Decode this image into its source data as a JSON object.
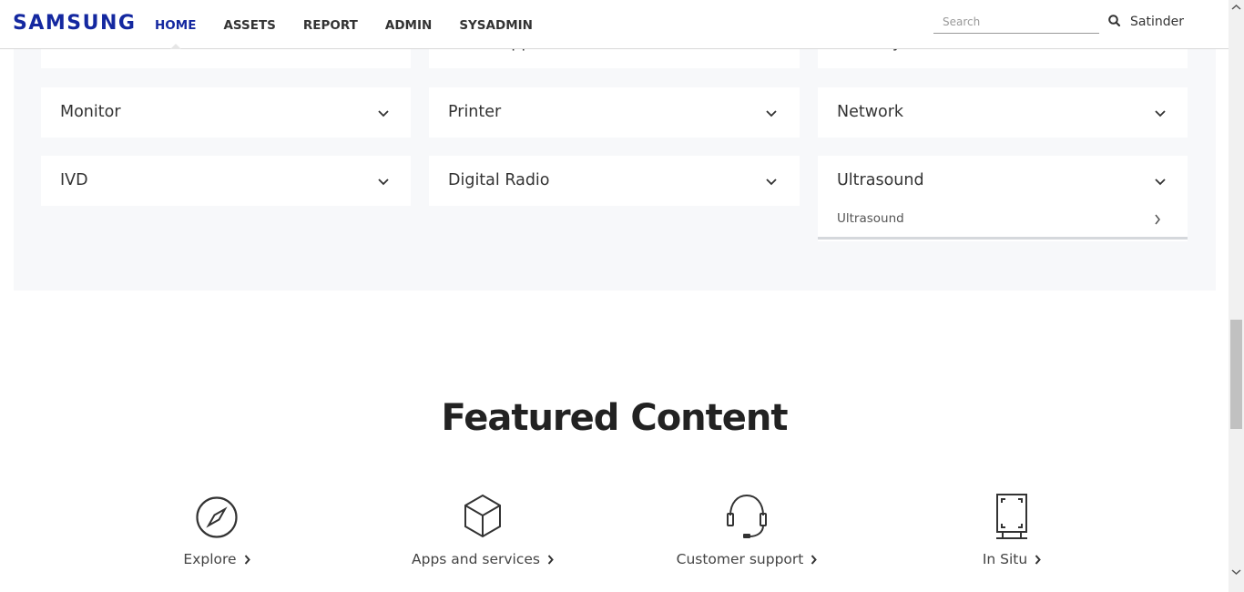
{
  "header": {
    "logo": "SAMSUNG",
    "nav": [
      "HOME",
      "ASSETS",
      "REPORT",
      "ADMIN",
      "SYSADMIN"
    ],
    "active_nav": "HOME",
    "search_placeholder": "Search",
    "user": "Satinder"
  },
  "categories": {
    "row0": [
      "Harman",
      "Home Appliance",
      "Memory"
    ],
    "row1": [
      "Monitor",
      "Printer",
      "Network"
    ],
    "row2": [
      "IVD",
      "Digital Radio",
      "Ultrasound"
    ],
    "expanded": {
      "category": "Ultrasound",
      "items": [
        "Ultrasound"
      ]
    }
  },
  "featured": {
    "title": "Featured Content",
    "items": [
      {
        "label": "Explore",
        "icon": "compass-icon"
      },
      {
        "label": "Apps and services",
        "icon": "cube-icon"
      },
      {
        "label": "Customer support",
        "icon": "headset-icon"
      },
      {
        "label": "In Situ",
        "icon": "device-frame-icon"
      }
    ]
  },
  "colors": {
    "brand": "#1428a0",
    "panel_bg": "#f7f8fa"
  }
}
